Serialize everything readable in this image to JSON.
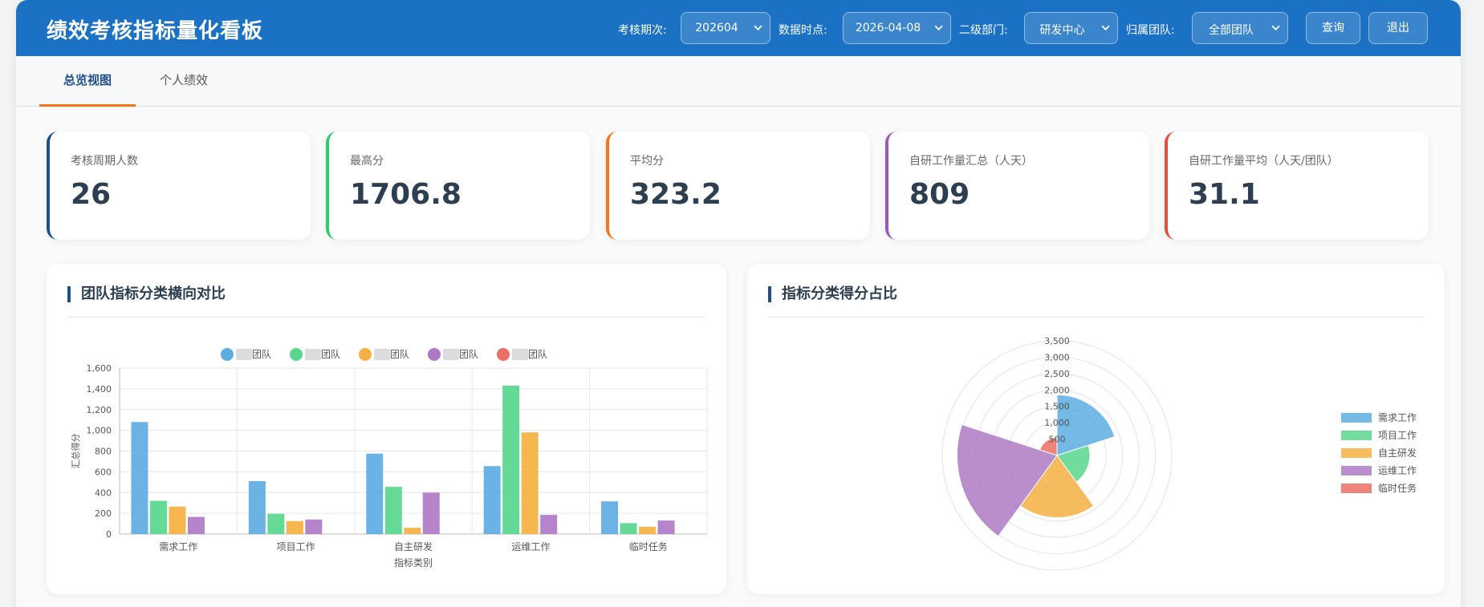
{
  "app": {
    "title": "绩效考核指标量化看板"
  },
  "filters": [
    {
      "label": "考核期次:",
      "value": "202604"
    },
    {
      "label": "数据时点:",
      "value": "2026-04-08"
    },
    {
      "label": "二级部门:",
      "value": "研发中心"
    },
    {
      "label": "归属团队:",
      "value": "全部团队"
    }
  ],
  "buttons": {
    "query": "查询",
    "logout": "退出"
  },
  "tabs": [
    {
      "label": "总览视图",
      "active": true
    },
    {
      "label": "个人绩效",
      "active": false
    }
  ],
  "kpis": [
    {
      "label": "考核周期人数",
      "value": "26",
      "color": "#1f4e8c"
    },
    {
      "label": "最高分",
      "value": "1706.8",
      "color": "#2ecc71"
    },
    {
      "label": "平均分",
      "value": "323.2",
      "color": "#f5761a"
    },
    {
      "label": "自研工作量汇总（人天）",
      "value": "809",
      "color": "#9b59b6"
    },
    {
      "label": "自研工作量平均（人天/团队）",
      "value": "31.1",
      "color": "#e74c3c"
    }
  ],
  "panels": {
    "bar": {
      "title": "团队指标分类横向对比"
    },
    "polar": {
      "title": "指标分类得分占比"
    }
  },
  "chart_data": [
    {
      "type": "bar",
      "categories": [
        "需求工作",
        "项目工作",
        "自主研发",
        "运维工作",
        "临时任务"
      ],
      "series": [
        {
          "name": "团队",
          "color": "#5dade2",
          "values": [
            1080,
            510,
            775,
            655,
            315
          ]
        },
        {
          "name": "团队",
          "color": "#58d68d",
          "values": [
            320,
            195,
            455,
            1430,
            105
          ]
        },
        {
          "name": "团队",
          "color": "#f5b041",
          "values": [
            265,
            125,
            60,
            980,
            70
          ]
        },
        {
          "name": "团队",
          "color": "#af7ac5",
          "values": [
            165,
            140,
            400,
            185,
            130
          ]
        },
        {
          "name": "团队",
          "color": "#ec7063",
          "values": [
            0,
            0,
            0,
            0,
            0
          ]
        }
      ],
      "xlabel": "指标类别",
      "ylabel": "汇总得分",
      "ylim": [
        0,
        1600
      ],
      "yticks": [
        0,
        200,
        400,
        600,
        800,
        1000,
        1200,
        1400,
        1600
      ],
      "ytick_labels": [
        "0",
        "200",
        "400",
        "600",
        "800",
        "1,000",
        "1,200",
        "1,400",
        "1,600"
      ],
      "grid": true,
      "legend": "top"
    },
    {
      "type": "polar-area",
      "categories": [
        "需求工作",
        "项目工作",
        "自主研发",
        "运维工作",
        "临时任务"
      ],
      "colors": [
        "#5dade2",
        "#58d68d",
        "#f5b041",
        "#af7ac5",
        "#ec7063"
      ],
      "values": [
        1850,
        1000,
        1900,
        3050,
        550
      ],
      "rlim": [
        0,
        3500
      ],
      "rticks": [
        500,
        1000,
        1500,
        2000,
        2500,
        3000,
        3500
      ],
      "rtick_labels": [
        "500",
        "1,000",
        "1,500",
        "2,000",
        "2,500",
        "3,000",
        "3,500"
      ],
      "legend": "right"
    }
  ]
}
